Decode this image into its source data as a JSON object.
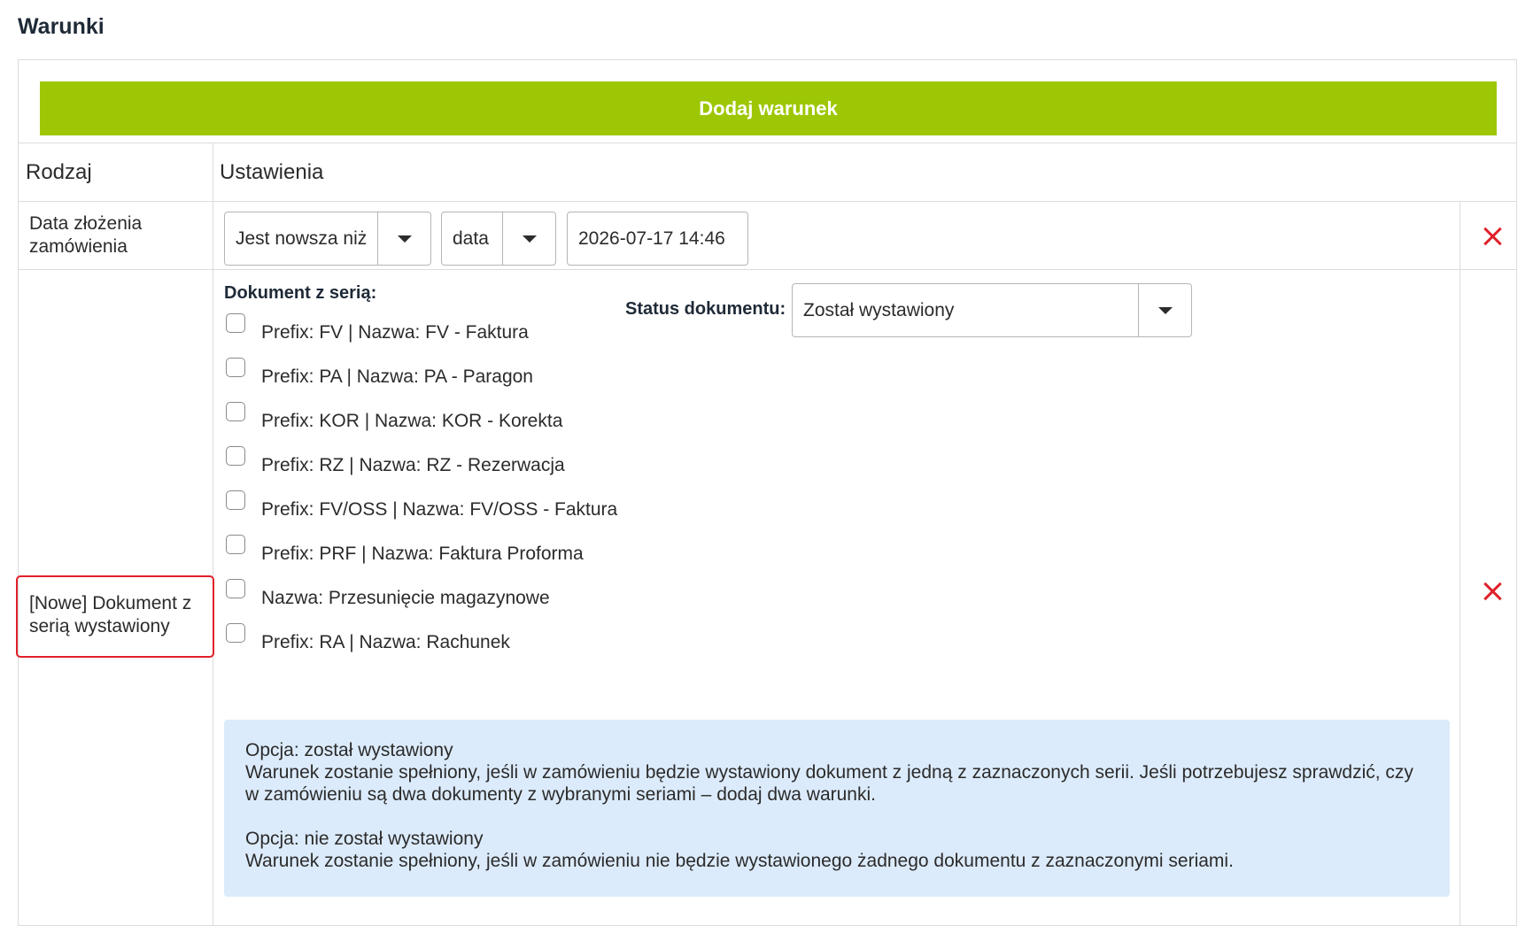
{
  "section": {
    "title": "Warunki"
  },
  "toolbar": {
    "add_condition_label": "Dodaj warunek"
  },
  "table": {
    "headers": {
      "kind": "Rodzaj",
      "settings": "Ustawienia"
    },
    "rows": [
      {
        "kind": "Data złożenia zamówienia",
        "comparator": "Jest nowsza niż",
        "unit": "data",
        "date_value": "2026-07-17 14:46"
      },
      {
        "kind": "[Nowe] Dokument z serią wystawiony",
        "series_label": "Dokument z serią:",
        "status_label": "Status dokumentu:",
        "status_value": "Został wystawiony",
        "series": [
          {
            "label": "Prefix: FV | Nazwa: FV - Faktura",
            "checked": false
          },
          {
            "label": "Prefix: PA | Nazwa: PA - Paragon",
            "checked": false
          },
          {
            "label": "Prefix: KOR | Nazwa: KOR - Korekta",
            "checked": false
          },
          {
            "label": "Prefix: RZ | Nazwa: RZ - Rezerwacja",
            "checked": false
          },
          {
            "label": "Prefix: FV/OSS | Nazwa: FV/OSS - Faktura",
            "checked": false
          },
          {
            "label": "Prefix: PRF | Nazwa: Faktura Proforma",
            "checked": false
          },
          {
            "label": "Nazwa: Przesunięcie magazynowe",
            "checked": false
          },
          {
            "label": "Prefix: RA | Nazwa: Rachunek",
            "checked": false
          }
        ],
        "info": {
          "opt1_title": "Opcja: został wystawiony",
          "opt1_text": "Warunek zostanie spełniony, jeśli w zamówieniu będzie wystawiony dokument z jedną z zaznaczonych serii. Jeśli potrzebujesz sprawdzić, czy w zamówieniu są dwa dokumenty z wybranymi seriami – dodaj dwa warunki.",
          "opt2_title": "Opcja: nie został wystawiony",
          "opt2_text": "Warunek zostanie spełniony, jeśli w zamówieniu nie będzie wystawionego żadnego dokumentu z zaznaczonymi seriami."
        }
      }
    ]
  },
  "colors": {
    "accent_green": "#9dc704",
    "remove_red": "#e0202a",
    "info_bg": "#dcebfb",
    "highlight_red": "#e0202a"
  },
  "icons": {
    "remove": "close-icon",
    "dropdown": "chevron-down-icon"
  }
}
